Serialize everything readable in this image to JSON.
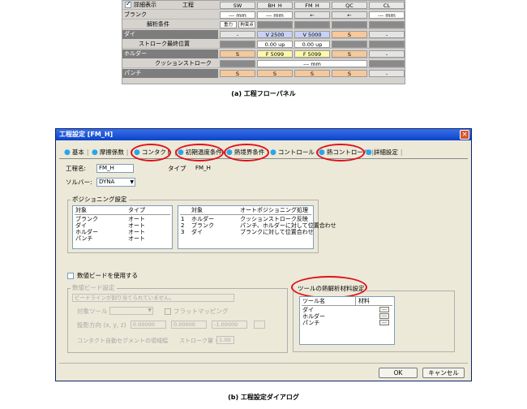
{
  "panel_a": {
    "header": {
      "checkbox_label": "詳細表示",
      "process_label": "工程",
      "columns": [
        "SW",
        "BH_H",
        "FM_H",
        "QC",
        "CL"
      ]
    },
    "rows": [
      {
        "label": "ブランク",
        "cells": [
          "--- mm",
          "--- mm",
          "←",
          "←",
          "--- mm"
        ]
      },
      {
        "label": "解析条件",
        "cells": [
          "重力",
          "拘束点"
        ]
      },
      {
        "label": "ダイ",
        "cells": [
          "-",
          "V 2500",
          "V 5000",
          "S",
          "-"
        ]
      },
      {
        "label": "ストローク最終位置",
        "cells": [
          "0.00 up",
          "0.00 up"
        ]
      },
      {
        "label": "ホルダー",
        "cells": [
          "S",
          "F 5099",
          "F 5099",
          "S",
          "-"
        ]
      },
      {
        "label": "クッションストローク",
        "cells": [
          "--- mm"
        ]
      },
      {
        "label": "パンチ",
        "cells": [
          "S",
          "S",
          "S",
          "S",
          "-"
        ]
      }
    ],
    "caption": "(a) 工程フローパネル"
  },
  "dialog": {
    "title": "工程設定 [FM_H]",
    "close_glyph": "×",
    "tabs": [
      "基本",
      "摩擦係数",
      "コンタクト",
      "初期温度条件",
      "熱境界条件",
      "コントロール",
      "熱コントロール",
      "詳細設定"
    ],
    "process_name_label": "工程名:",
    "process_name_value": "FM_H",
    "type_label": "タイプ",
    "type_value": "FM_H",
    "solver_label": "ソルバー:",
    "solver_value": "DYNA",
    "positioning": {
      "group_label": "ポジショニング設定",
      "left_headers": [
        "対象",
        "タイプ"
      ],
      "left_rows": [
        [
          "ブランク",
          "オート"
        ],
        [
          "ダイ",
          "オート"
        ],
        [
          "ホルダー",
          "オート"
        ],
        [
          "パンチ",
          "オート"
        ]
      ],
      "right_headers": [
        "対象",
        "オートポジショニング処理"
      ],
      "right_rows": [
        [
          "1",
          "ホルダー",
          "クッションストローク反映"
        ],
        [
          "2",
          "ブランク",
          "パンチ、ホルダーに対して位置合わせ"
        ],
        [
          "3",
          "ダイ",
          "ブランクに対して位置合わせ"
        ]
      ]
    },
    "drawbead": {
      "checkbox_label": "数値ビードを使用する",
      "group_label": "数値ビード設定",
      "note": "ビードラインが割り当てられていません。",
      "target_tool_label": "対象ツール",
      "flat_mapping_label": "フラットマッピング",
      "projection_label": "投影方向 (x, y, z)",
      "proj_x": "0.00000",
      "proj_y": "0.00000",
      "proj_z": "-1.00000",
      "contact_label": "コンタクト自動セグメントの領域幅",
      "stroke_label": "ストローク量 =",
      "stroke_value": "1.00"
    },
    "thermal_material": {
      "group_label": "ツールの熱解析材料設定",
      "headers": [
        "ツール名",
        "材料"
      ],
      "rows": [
        "ダイ",
        "ホルダー",
        "パンチ"
      ],
      "ellipsis": "..."
    },
    "ok_label": "OK",
    "cancel_label": "キャンセル"
  },
  "caption_b": "(b) 工程設定ダイアログ"
}
